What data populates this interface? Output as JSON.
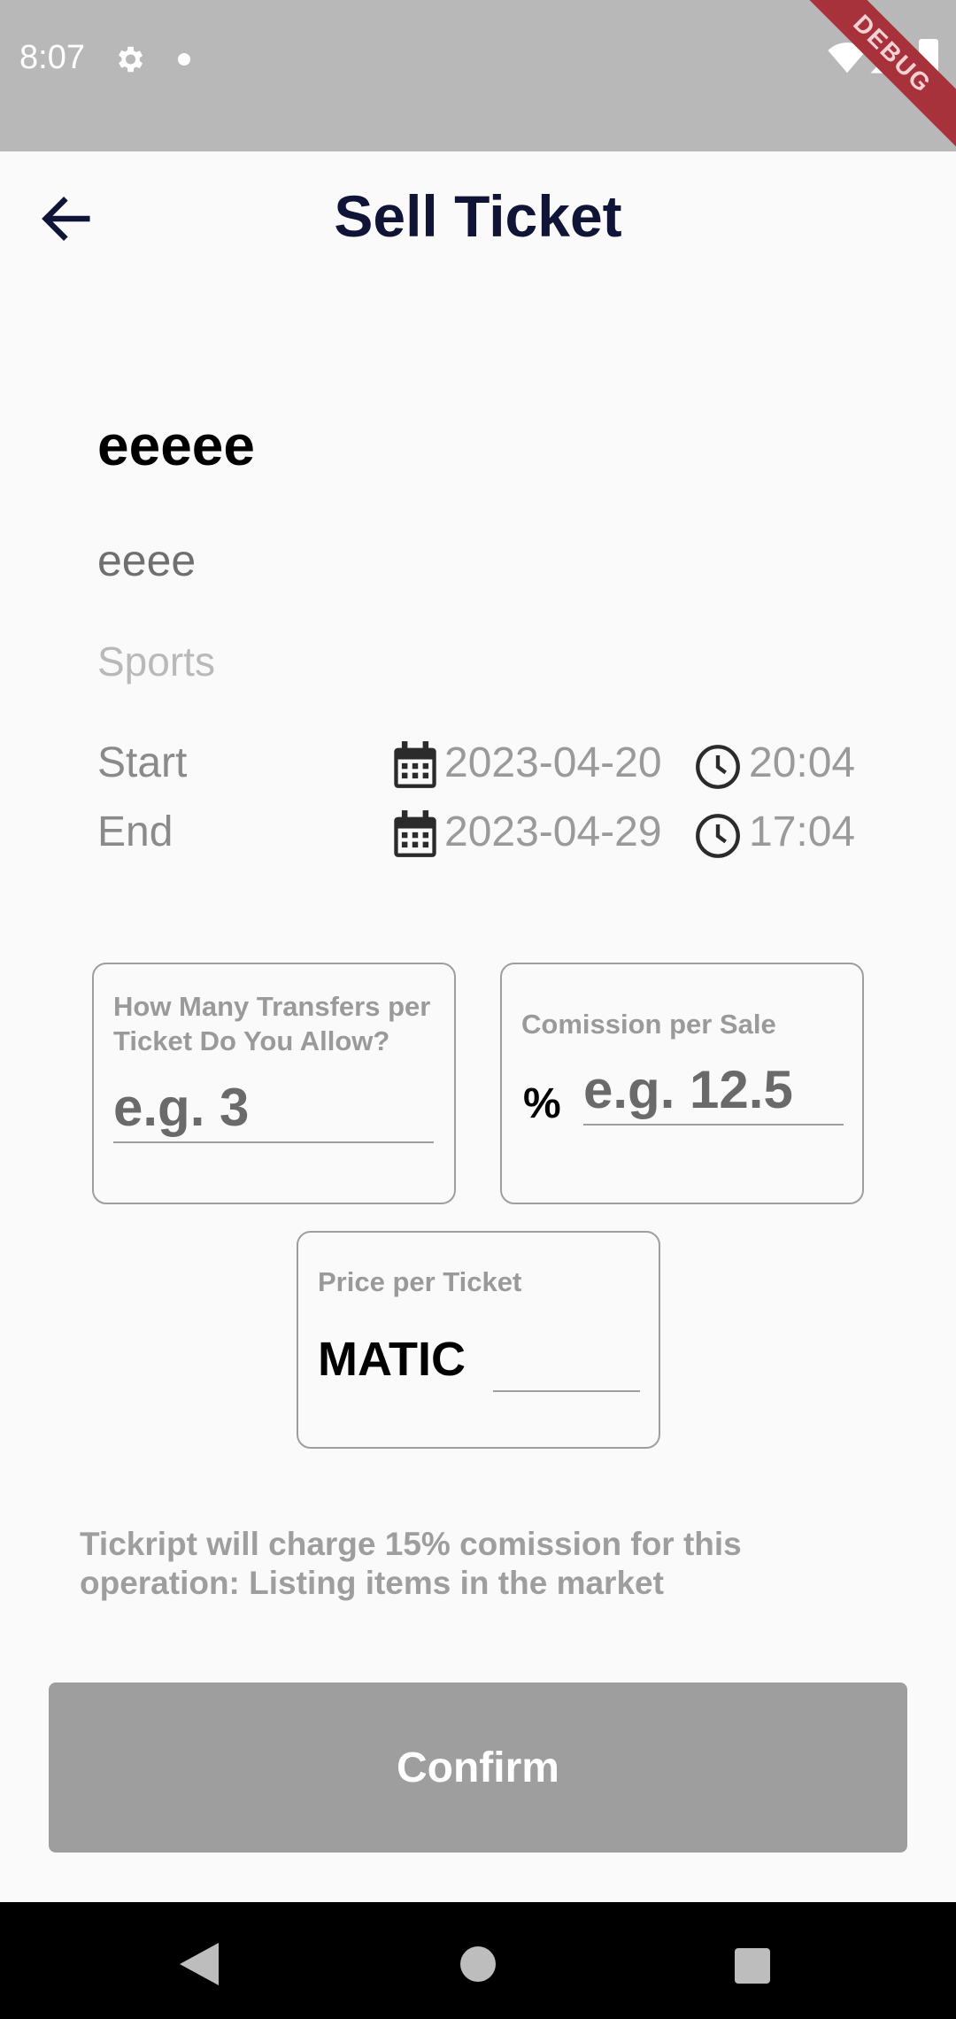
{
  "status_bar": {
    "time": "8:07",
    "debug_label": "DEBUG"
  },
  "app_bar": {
    "title": "Sell Ticket",
    "back_icon": "arrow-left-icon"
  },
  "event": {
    "name": "eeeee",
    "description": "eeee",
    "category": "Sports",
    "start": {
      "label": "Start",
      "date": "2023-04-20",
      "time": "20:04"
    },
    "end": {
      "label": "End",
      "date": "2023-04-29",
      "time": "17:04"
    }
  },
  "form": {
    "transfers": {
      "label": "How Many Transfers per Ticket Do You Allow?",
      "placeholder": "e.g. 3",
      "value": ""
    },
    "commission": {
      "label": "Comission per Sale",
      "prefix": "%",
      "placeholder": "e.g. 12.5",
      "value": ""
    },
    "price": {
      "label": "Price per Ticket",
      "prefix": "MATIC",
      "placeholder": "",
      "value": ""
    }
  },
  "notice": "Tickript will charge 15% comission for this operation: Listing items in the market",
  "confirm_label": "Confirm",
  "colors": {
    "title": "#101436",
    "button_disabled": "#9e9e9e",
    "status_bar": "#b8b8b8"
  }
}
